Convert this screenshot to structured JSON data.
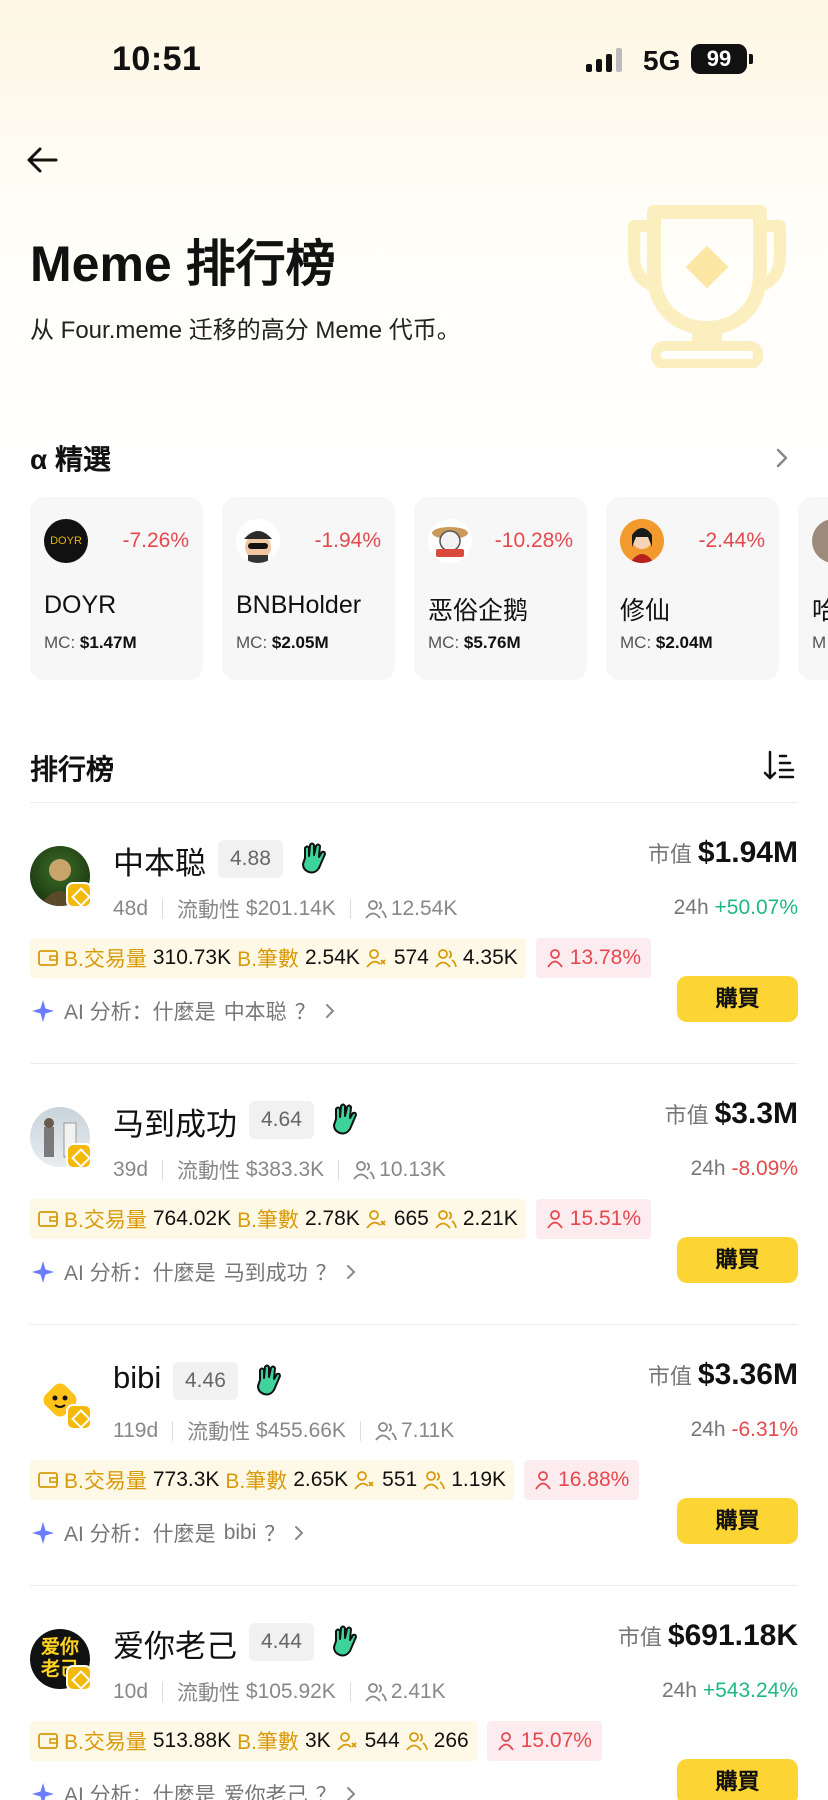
{
  "status": {
    "time": "10:51",
    "network": "5G",
    "battery": "99"
  },
  "header": {
    "title": "Meme 排行榜",
    "subtitle": "从 Four.meme 迁移的高分 Meme 代币。"
  },
  "alpha": {
    "heading": "α 精選",
    "cards": [
      {
        "name": "DOYR",
        "change": "-7.26%",
        "mc_label": "MC:",
        "mc_value": "$1.47M",
        "avatar_text": "DOYR"
      },
      {
        "name": "BNBHolder",
        "change": "-1.94%",
        "mc_label": "MC:",
        "mc_value": "$2.05M"
      },
      {
        "name": "恶俗企鹅",
        "change": "-10.28%",
        "mc_label": "MC:",
        "mc_value": "$5.76M"
      },
      {
        "name": "修仙",
        "change": "-2.44%",
        "mc_label": "MC:",
        "mc_value": "$2.04M"
      },
      {
        "name": "哈",
        "change": "",
        "mc_label": "M",
        "mc_value": ""
      }
    ]
  },
  "ranking": {
    "heading": "排行榜",
    "labels": {
      "mcap": "市值",
      "h24": "24h",
      "liquidity": "流動性",
      "bvol": "B.交易量",
      "bcount": "B.筆數",
      "buy": "購買",
      "ai_prefix": "AI 分析：什麼是",
      "ai_suffix": "？"
    },
    "items": [
      {
        "name": "中本聪",
        "score": "4.88",
        "age": "48d",
        "liquidity": "$201.14K",
        "holders": "12.54K",
        "mcap": "$1.94M",
        "change24": "+50.07%",
        "bvol": "310.73K",
        "bcount": "2.54K",
        "s1": "574",
        "s2": "4.35K",
        "pct": "13.78%"
      },
      {
        "name": "马到成功",
        "score": "4.64",
        "age": "39d",
        "liquidity": "$383.3K",
        "holders": "10.13K",
        "mcap": "$3.3M",
        "change24": "-8.09%",
        "bvol": "764.02K",
        "bcount": "2.78K",
        "s1": "665",
        "s2": "2.21K",
        "pct": "15.51%"
      },
      {
        "name": "bibi",
        "score": "4.46",
        "age": "119d",
        "liquidity": "$455.66K",
        "holders": "7.11K",
        "mcap": "$3.36M",
        "change24": "-6.31%",
        "bvol": "773.3K",
        "bcount": "2.65K",
        "s1": "551",
        "s2": "1.19K",
        "pct": "16.88%"
      },
      {
        "name": "爱你老己",
        "score": "4.44",
        "age": "10d",
        "liquidity": "$105.92K",
        "holders": "2.41K",
        "mcap": "$691.18K",
        "change24": "+543.24%",
        "bvol": "513.88K",
        "bcount": "3K",
        "s1": "544",
        "s2": "266",
        "pct": "15.07%",
        "avatar_text": "爱你老己"
      }
    ]
  },
  "colors": {
    "accent": "#fcd535",
    "up": "#1eb980",
    "down": "#e5484d",
    "label_gold": "#d99a0a"
  }
}
